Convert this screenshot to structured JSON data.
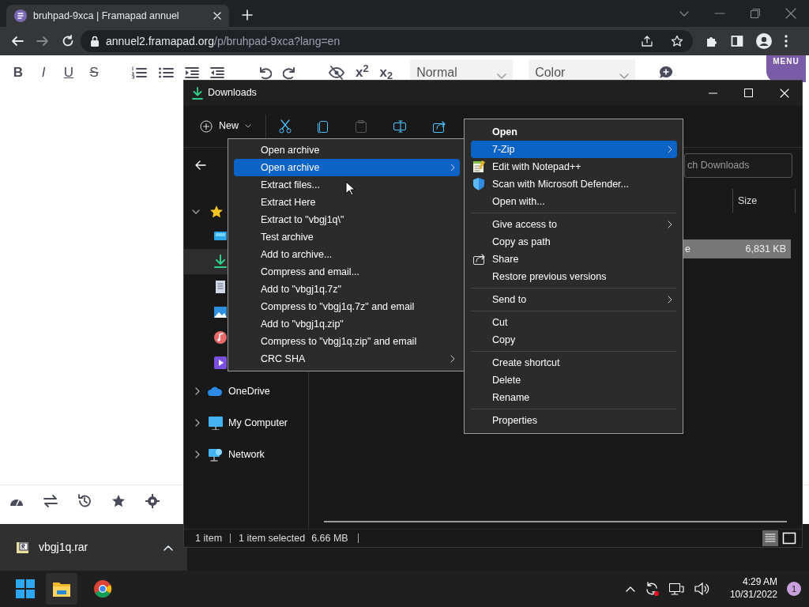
{
  "browser": {
    "tab": {
      "title": "bruhpad-9xca | Framapad annuel",
      "selected": true
    },
    "url": {
      "host": "annuel2.framapad.org",
      "path": "/p/bruhpad-9xca?lang=en"
    }
  },
  "editor": {
    "format_buttons": [
      {
        "kind": "bold",
        "label": "B"
      },
      {
        "kind": "italic",
        "label": "I"
      },
      {
        "kind": "underline",
        "label": "U"
      },
      {
        "kind": "strike",
        "label": "S"
      }
    ],
    "script_buttons": [
      {
        "label": "x$^{2}$"
      },
      {
        "label": "x$_{2}$"
      }
    ],
    "style_select": "Normal",
    "color_select": "Color",
    "menu_label": "MENU"
  },
  "downloads_bar": {
    "file": "vbgj1q.rar"
  },
  "explorer": {
    "title": "Downloads",
    "new_label": "New",
    "search_placeholder": "ch Downloads",
    "column": "Size",
    "quick_access": {
      "expanded": true,
      "children": [
        {
          "kind": "desktop",
          "selected": false
        },
        {
          "kind": "downloads",
          "selected": true
        },
        {
          "kind": "documents",
          "selected": false
        },
        {
          "kind": "pictures",
          "selected": false
        },
        {
          "kind": "music",
          "selected": false
        },
        {
          "kind": "videos",
          "selected": false
        }
      ]
    },
    "locations": [
      {
        "label": "OneDrive",
        "kind": "cloud",
        "expanded": false
      },
      {
        "label": "My Computer",
        "kind": "computer",
        "expanded": false
      },
      {
        "label": "Network",
        "kind": "network",
        "expanded": false
      }
    ],
    "file": {
      "cell": "e",
      "size": "6,831 KB",
      "selected": true
    },
    "status": {
      "count": "1 item",
      "selection": "1 item selected",
      "size": "6.66 MB"
    }
  },
  "zip_menu": {
    "items": [
      {
        "label": "Open archive",
        "selected": false,
        "submenu": false
      },
      {
        "label": "Open archive",
        "selected": true,
        "submenu": true
      },
      {
        "label": "Extract files...",
        "selected": false,
        "submenu": false
      },
      {
        "label": "Extract Here",
        "selected": false,
        "submenu": false
      },
      {
        "label": "Extract to \"vbgj1q\\\"",
        "selected": false,
        "submenu": false
      },
      {
        "label": "Test archive",
        "selected": false,
        "submenu": false
      },
      {
        "label": "Add to archive...",
        "selected": false,
        "submenu": false
      },
      {
        "label": "Compress and email...",
        "selected": false,
        "submenu": false
      },
      {
        "label": "Add to \"vbgj1q.7z\"",
        "selected": false,
        "submenu": false
      },
      {
        "label": "Compress to \"vbgj1q.7z\" and email",
        "selected": false,
        "submenu": false
      },
      {
        "label": "Add to \"vbgj1q.zip\"",
        "selected": false,
        "submenu": false
      },
      {
        "label": "Compress to \"vbgj1q.zip\" and email",
        "selected": false,
        "submenu": false
      },
      {
        "label": "CRC SHA",
        "selected": false,
        "submenu": true
      }
    ]
  },
  "context_menu": {
    "items": [
      {
        "kind": "item",
        "label": "Open",
        "bold": true,
        "selected": false,
        "submenu": false
      },
      {
        "kind": "item",
        "label": "7-Zip",
        "bold": false,
        "selected": true,
        "submenu": true
      },
      {
        "kind": "notepad",
        "label": "Edit with Notepad++",
        "bold": false,
        "selected": false,
        "submenu": false
      },
      {
        "kind": "defender",
        "label": "Scan with Microsoft Defender...",
        "bold": false,
        "selected": false,
        "submenu": false
      },
      {
        "kind": "item",
        "label": "Open with...",
        "bold": false,
        "selected": false,
        "submenu": false
      },
      {
        "kind": "separator"
      },
      {
        "kind": "item",
        "label": "Give access to",
        "bold": false,
        "selected": false,
        "submenu": true
      },
      {
        "kind": "item",
        "label": "Copy as path",
        "bold": false,
        "selected": false,
        "submenu": false
      },
      {
        "kind": "share",
        "label": "Share",
        "bold": false,
        "selected": false,
        "submenu": false
      },
      {
        "kind": "item",
        "label": "Restore previous versions",
        "bold": false,
        "selected": false,
        "submenu": false
      },
      {
        "kind": "separator"
      },
      {
        "kind": "item",
        "label": "Send to",
        "bold": false,
        "selected": false,
        "submenu": true
      },
      {
        "kind": "separator"
      },
      {
        "kind": "item",
        "label": "Cut",
        "bold": false,
        "selected": false,
        "submenu": false
      },
      {
        "kind": "item",
        "label": "Copy",
        "bold": false,
        "selected": false,
        "submenu": false
      },
      {
        "kind": "separator"
      },
      {
        "kind": "item",
        "label": "Create shortcut",
        "bold": false,
        "selected": false,
        "submenu": false
      },
      {
        "kind": "item",
        "label": "Delete",
        "bold": false,
        "selected": false,
        "submenu": false
      },
      {
        "kind": "item",
        "label": "Rename",
        "bold": false,
        "selected": false,
        "submenu": false
      },
      {
        "kind": "separator"
      },
      {
        "kind": "item",
        "label": "Properties",
        "bold": false,
        "selected": false,
        "submenu": false
      }
    ]
  },
  "taskbar": {
    "time": "4:29 AM",
    "date": "10/31/2022",
    "notifications": "1"
  }
}
